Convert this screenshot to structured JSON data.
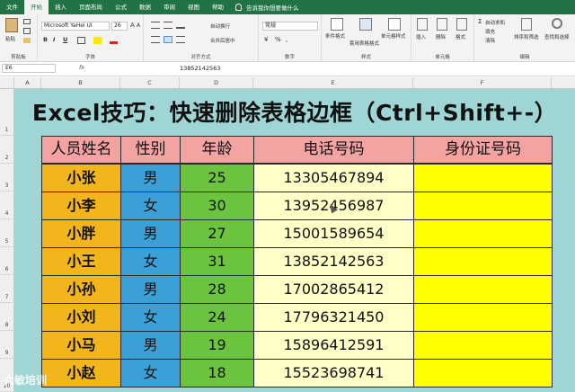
{
  "tabs": [
    "文件",
    "开始",
    "插入",
    "页面布局",
    "公式",
    "数据",
    "审阅",
    "视图",
    "帮助"
  ],
  "tell_me": "告诉我你想要做什么",
  "ribbon": {
    "clipboard": {
      "paste": "粘贴",
      "label": "剪贴板"
    },
    "font": {
      "name": "Microsoft YaHei UI",
      "size": "26",
      "label": "字体",
      "bold": "B",
      "italic": "I",
      "underline": "U"
    },
    "alignment": {
      "wrap": "自动换行",
      "merge": "合并后居中",
      "label": "对齐方式"
    },
    "number": {
      "format": "常规",
      "label": "数字"
    },
    "styles": {
      "conditional": "条件格式",
      "table": "套用表格格式",
      "cell_styles": "单元格样式",
      "label": "样式"
    },
    "cells": {
      "insert": "插入",
      "delete": "删除",
      "format": "格式",
      "label": "单元格"
    },
    "editing": {
      "autosum": "自动求和",
      "fill": "填充",
      "clear": "清除",
      "sort": "排序和筛选",
      "find": "查找和选择",
      "label": "编辑"
    }
  },
  "formula_bar": {
    "name_box": "E6",
    "fx": "fx",
    "content": "13852142563"
  },
  "columns": [
    "A",
    "B",
    "C",
    "D",
    "E",
    "F"
  ],
  "rows": [
    "1",
    "2",
    "3",
    "4",
    "5",
    "6",
    "7",
    "8",
    "9",
    "10"
  ],
  "title": "Excel技巧：快速删除表格边框（Ctrl+Shift+-）",
  "table": {
    "headers": [
      "人员姓名",
      "性别",
      "年龄",
      "电话号码",
      "身份证号码"
    ],
    "rows": [
      [
        "小张",
        "男",
        "25",
        "13305467894",
        ""
      ],
      [
        "小李",
        "女",
        "30",
        "13952456987",
        ""
      ],
      [
        "小胖",
        "男",
        "27",
        "15001589654",
        ""
      ],
      [
        "小王",
        "女",
        "31",
        "13852142563",
        ""
      ],
      [
        "小孙",
        "男",
        "28",
        "17002865412",
        ""
      ],
      [
        "小刘",
        "女",
        "24",
        "17796321450",
        ""
      ],
      [
        "小马",
        "男",
        "19",
        "15896412591",
        ""
      ],
      [
        "小赵",
        "女",
        "18",
        "15523698741",
        ""
      ]
    ]
  },
  "watermark": "六敏培训",
  "colors": {
    "ribbon_green": "#217346",
    "sheet_bg": "#9fd6d5",
    "header_fill": "#f4a3a3",
    "name_fill": "#f3b51c",
    "sex_fill": "#3ba0d6",
    "age_fill": "#6bc33e",
    "phone_fill": "#ffffc8",
    "id_fill": "#ffff00"
  }
}
